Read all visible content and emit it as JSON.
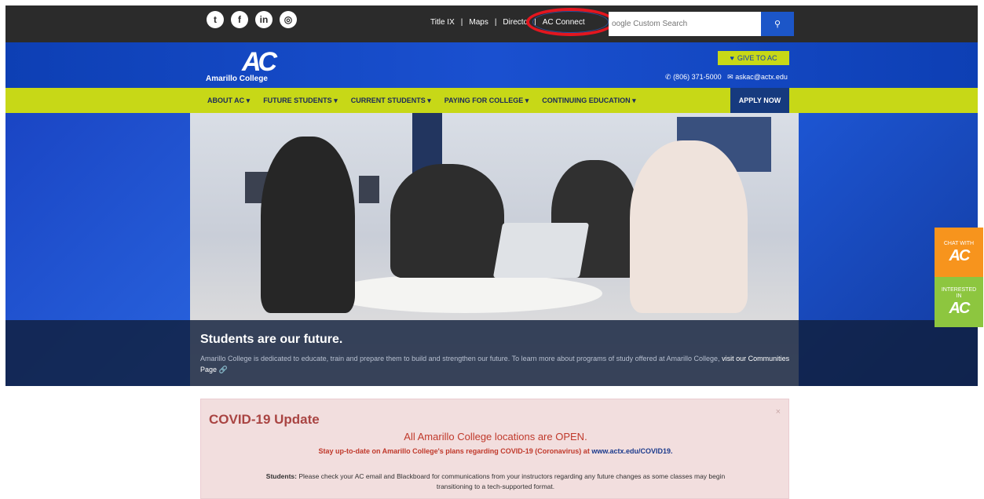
{
  "topbar": {
    "social": [
      {
        "icon": "twitter-icon",
        "glyph": "t"
      },
      {
        "icon": "facebook-icon",
        "glyph": "f"
      },
      {
        "icon": "linkedin-icon",
        "glyph": "in"
      },
      {
        "icon": "instagram-icon",
        "glyph": "◎"
      }
    ],
    "links": [
      "Title IX",
      "Maps",
      "Directo",
      "AC Connect"
    ],
    "separator": "|",
    "search_placeholder": "oogle Custom Search",
    "search_icon": "search-icon"
  },
  "header": {
    "logo_mark": "AC",
    "logo_name": "Amarillo College",
    "give_label": "GIVE TO AC",
    "phone": "(806) 371-5000",
    "email": "askac@actx.edu"
  },
  "nav": {
    "items": [
      "ABOUT AC ▾",
      "FUTURE STUDENTS ▾",
      "CURRENT STUDENTS ▾",
      "PAYING FOR COLLEGE ▾",
      "CONTINUING EDUCATION ▾"
    ],
    "apply": "APPLY NOW"
  },
  "hero": {
    "title": "Students are our future.",
    "text": "Amarillo College is dedicated to educate, train and prepare them to build and strengthen our future. To learn more about programs of study offered at Amarillo College,",
    "link": "visit our Communities Page"
  },
  "side_tabs": {
    "chat_label": "CHAT WITH",
    "chat_mark": "AC",
    "interested_label_1": "INTERESTED",
    "interested_label_2": "IN",
    "interested_mark": "AC"
  },
  "covid": {
    "close": "×",
    "title": "COVID-19 Update",
    "headline": "All Amarillo College locations are OPEN.",
    "sub_text": "Stay up-to-date on Amarillo College's plans regarding COVID-19 (Coronavirus) at",
    "sub_link": "www.actx.edu/COVID19.",
    "students_label": "Students:",
    "students_text": "Please check your AC email and Blackboard for communications from your instructors regarding any future changes as some classes may begin transitioning to a tech-supported format."
  },
  "colors": {
    "accent_lime": "#c7d817",
    "brand_blue": "#0d3fb4",
    "highlight_red": "#e3161f"
  }
}
